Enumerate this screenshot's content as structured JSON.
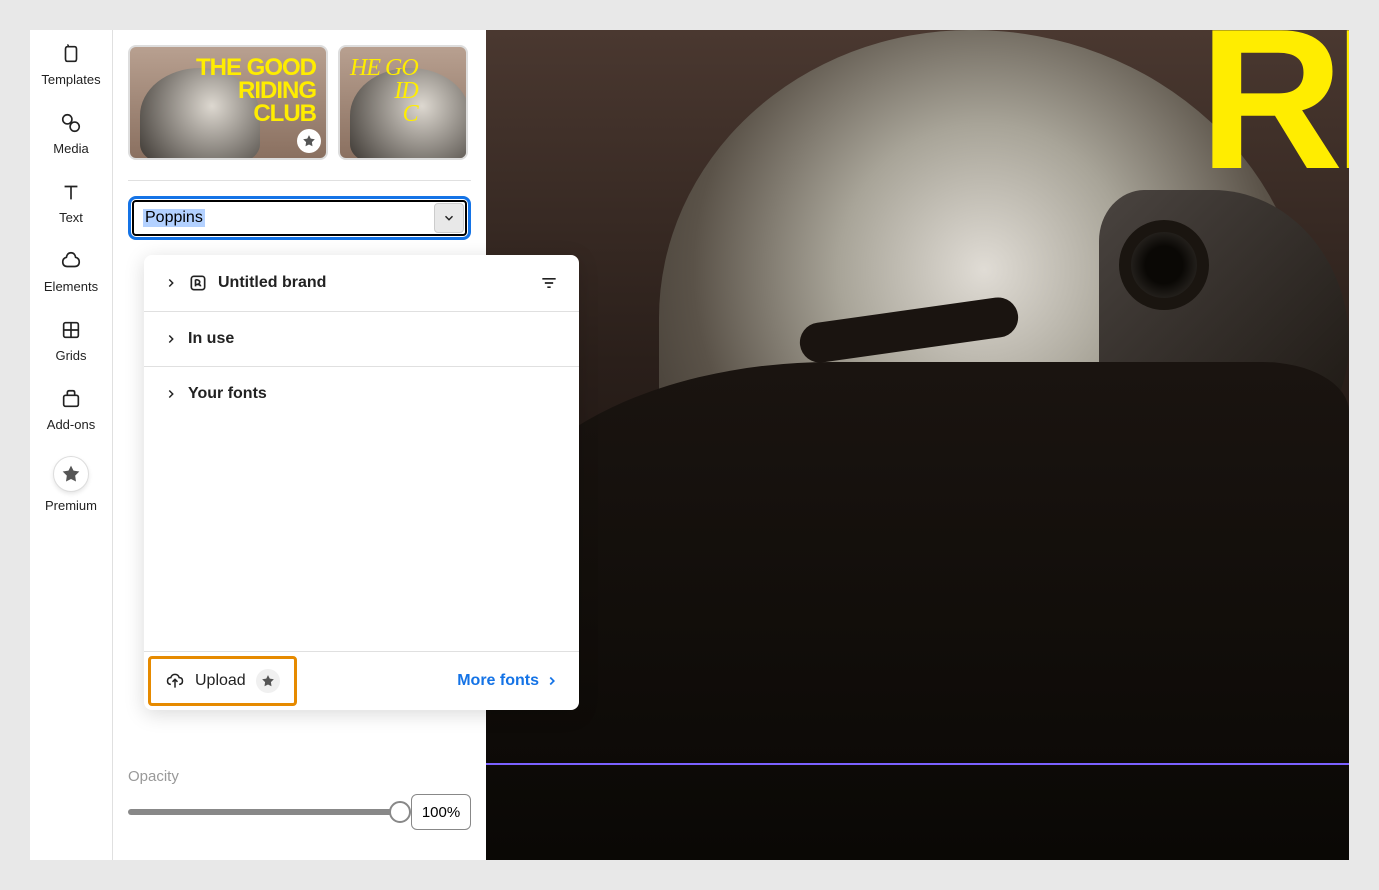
{
  "sidebar": {
    "items": [
      {
        "label": "Templates"
      },
      {
        "label": "Media"
      },
      {
        "label": "Text"
      },
      {
        "label": "Elements"
      },
      {
        "label": "Grids"
      },
      {
        "label": "Add-ons"
      },
      {
        "label": "Premium"
      }
    ]
  },
  "panel": {
    "thumbnail_text": "THE GOOD\nRIDING\nCLUB",
    "thumbnail_text_partial": "HE GO\nID\nC",
    "font_selected": "Poppins",
    "opacity_label": "Opacity",
    "opacity_value": "100%"
  },
  "dropdown": {
    "brand_label": "Untitled brand",
    "inuse_label": "In use",
    "yourfonts_label": "Your fonts",
    "upload_label": "Upload",
    "more_label": "More fonts"
  },
  "canvas": {
    "title": "RI"
  }
}
